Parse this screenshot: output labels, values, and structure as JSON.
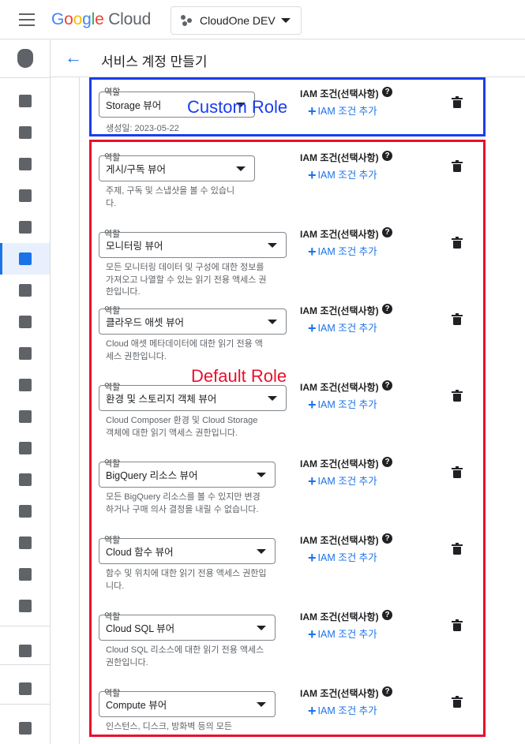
{
  "topbar": {
    "logo_letters": [
      "G",
      "o",
      "o",
      "g",
      "l",
      "e"
    ],
    "logo_product": "Cloud",
    "project_name": "CloudOne DEV"
  },
  "header": {
    "title": "서비스 계정 만들기"
  },
  "sidebar": {
    "items": [
      {
        "icon": "shield-account-icon"
      },
      {
        "icon": "person-add-icon"
      },
      {
        "icon": "account-circle-icon"
      },
      {
        "icon": "wrench-icon"
      },
      {
        "icon": "document-search-icon"
      },
      {
        "icon": "article-icon"
      },
      {
        "icon": "service-account-icon",
        "active": true
      },
      {
        "icon": "badge-icon"
      },
      {
        "icon": "tag-icon"
      },
      {
        "icon": "label-icon"
      },
      {
        "icon": "settings-icon"
      },
      {
        "icon": "security-icon"
      },
      {
        "icon": "list-alt-icon"
      },
      {
        "icon": "spy-icon"
      },
      {
        "icon": "list-icon"
      },
      {
        "icon": "contact-icon"
      },
      {
        "icon": "diamond-icon"
      },
      {
        "icon": "table-icon"
      },
      {
        "icon": "folder-settings-icon"
      },
      {
        "icon": "edit-note-icon"
      },
      {
        "icon": "expand-icon"
      }
    ]
  },
  "annotations": {
    "custom": "Custom Role",
    "default": "Default Role"
  },
  "common": {
    "role_label": "역할",
    "iam_condition_title": "IAM 조건(선택사항)",
    "iam_condition_title_short": "IAM 조건(선택사항)",
    "add_iam_condition": "IAM 조건 추가",
    "help_glyph": "?"
  },
  "custom_role": {
    "value": "Storage 뷰어",
    "created": "생성일: 2023-05-22"
  },
  "default_roles": [
    {
      "value": "게시/구독 뷰어",
      "desc": [
        "주제, 구독 및 스냅샷을 볼 수 있습니",
        "다."
      ]
    },
    {
      "value": "모니터링 뷰어",
      "desc": [
        "모든 모니터링 데이터 및 구성에 대한 정보를",
        "가져오고 나열할 수 있는 읽기 전용 액세스 권",
        "한입니다."
      ]
    },
    {
      "value": "클라우드 애셋 뷰어",
      "desc": [
        "Cloud 애셋 메타데이터에 대한 읽기 전용 액",
        "세스 권한입니다."
      ]
    },
    {
      "value": "환경 및 스토리지 객체 뷰어",
      "desc": [
        "Cloud Composer 환경 및 Cloud Storage",
        "객체에 대한 읽기 액세스 권한입니다."
      ]
    },
    {
      "value": "BigQuery 리소스 뷰어",
      "desc": [
        "모든 BigQuery 리소스를 볼 수 있지만 변경",
        "하거나 구매 의사 결정을 내릴 수 없습니다."
      ]
    },
    {
      "value": "Cloud 함수 뷰어",
      "desc": [
        "함수 및 위치에 대한 읽기 전용 액세스 권한입",
        "니다."
      ]
    },
    {
      "value": "Cloud SQL 뷰어",
      "desc": [
        "Cloud SQL 리소스에 대한 읽기 전용 액세스",
        "권한입니다."
      ]
    },
    {
      "value": "Compute 뷰어",
      "desc": [
        "인스턴스, 디스크, 방화벽 등의 모든"
      ]
    }
  ]
}
